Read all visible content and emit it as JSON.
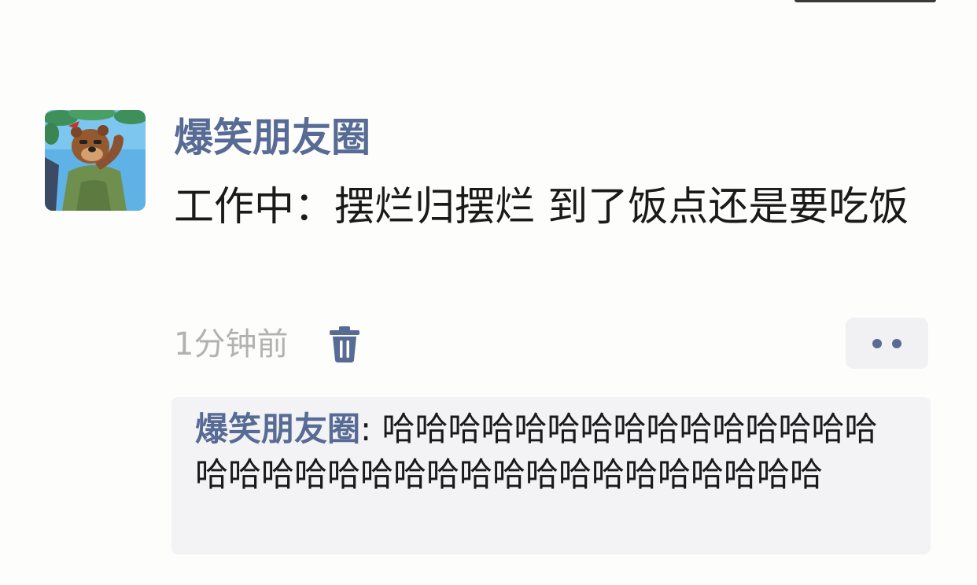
{
  "post": {
    "author": "爆笑朋友圈",
    "text": "工作中：摆烂归摆烂 到了饭点还是要吃饭",
    "time": "1分钟前"
  },
  "icons": {
    "delete": "trash-icon",
    "more": "more-dots-icon"
  },
  "comments": [
    {
      "author": "爆笑朋友圈",
      "separator": ": ",
      "text": "哈哈哈哈哈哈哈哈哈哈哈哈哈哈哈哈哈哈哈哈哈哈哈哈哈哈哈哈哈哈哈哈哈哈"
    }
  ],
  "colors": {
    "link": "#576b95",
    "text": "#1a1a1a",
    "muted": "#b2b2b2",
    "comment_bg": "#f3f3f5"
  }
}
